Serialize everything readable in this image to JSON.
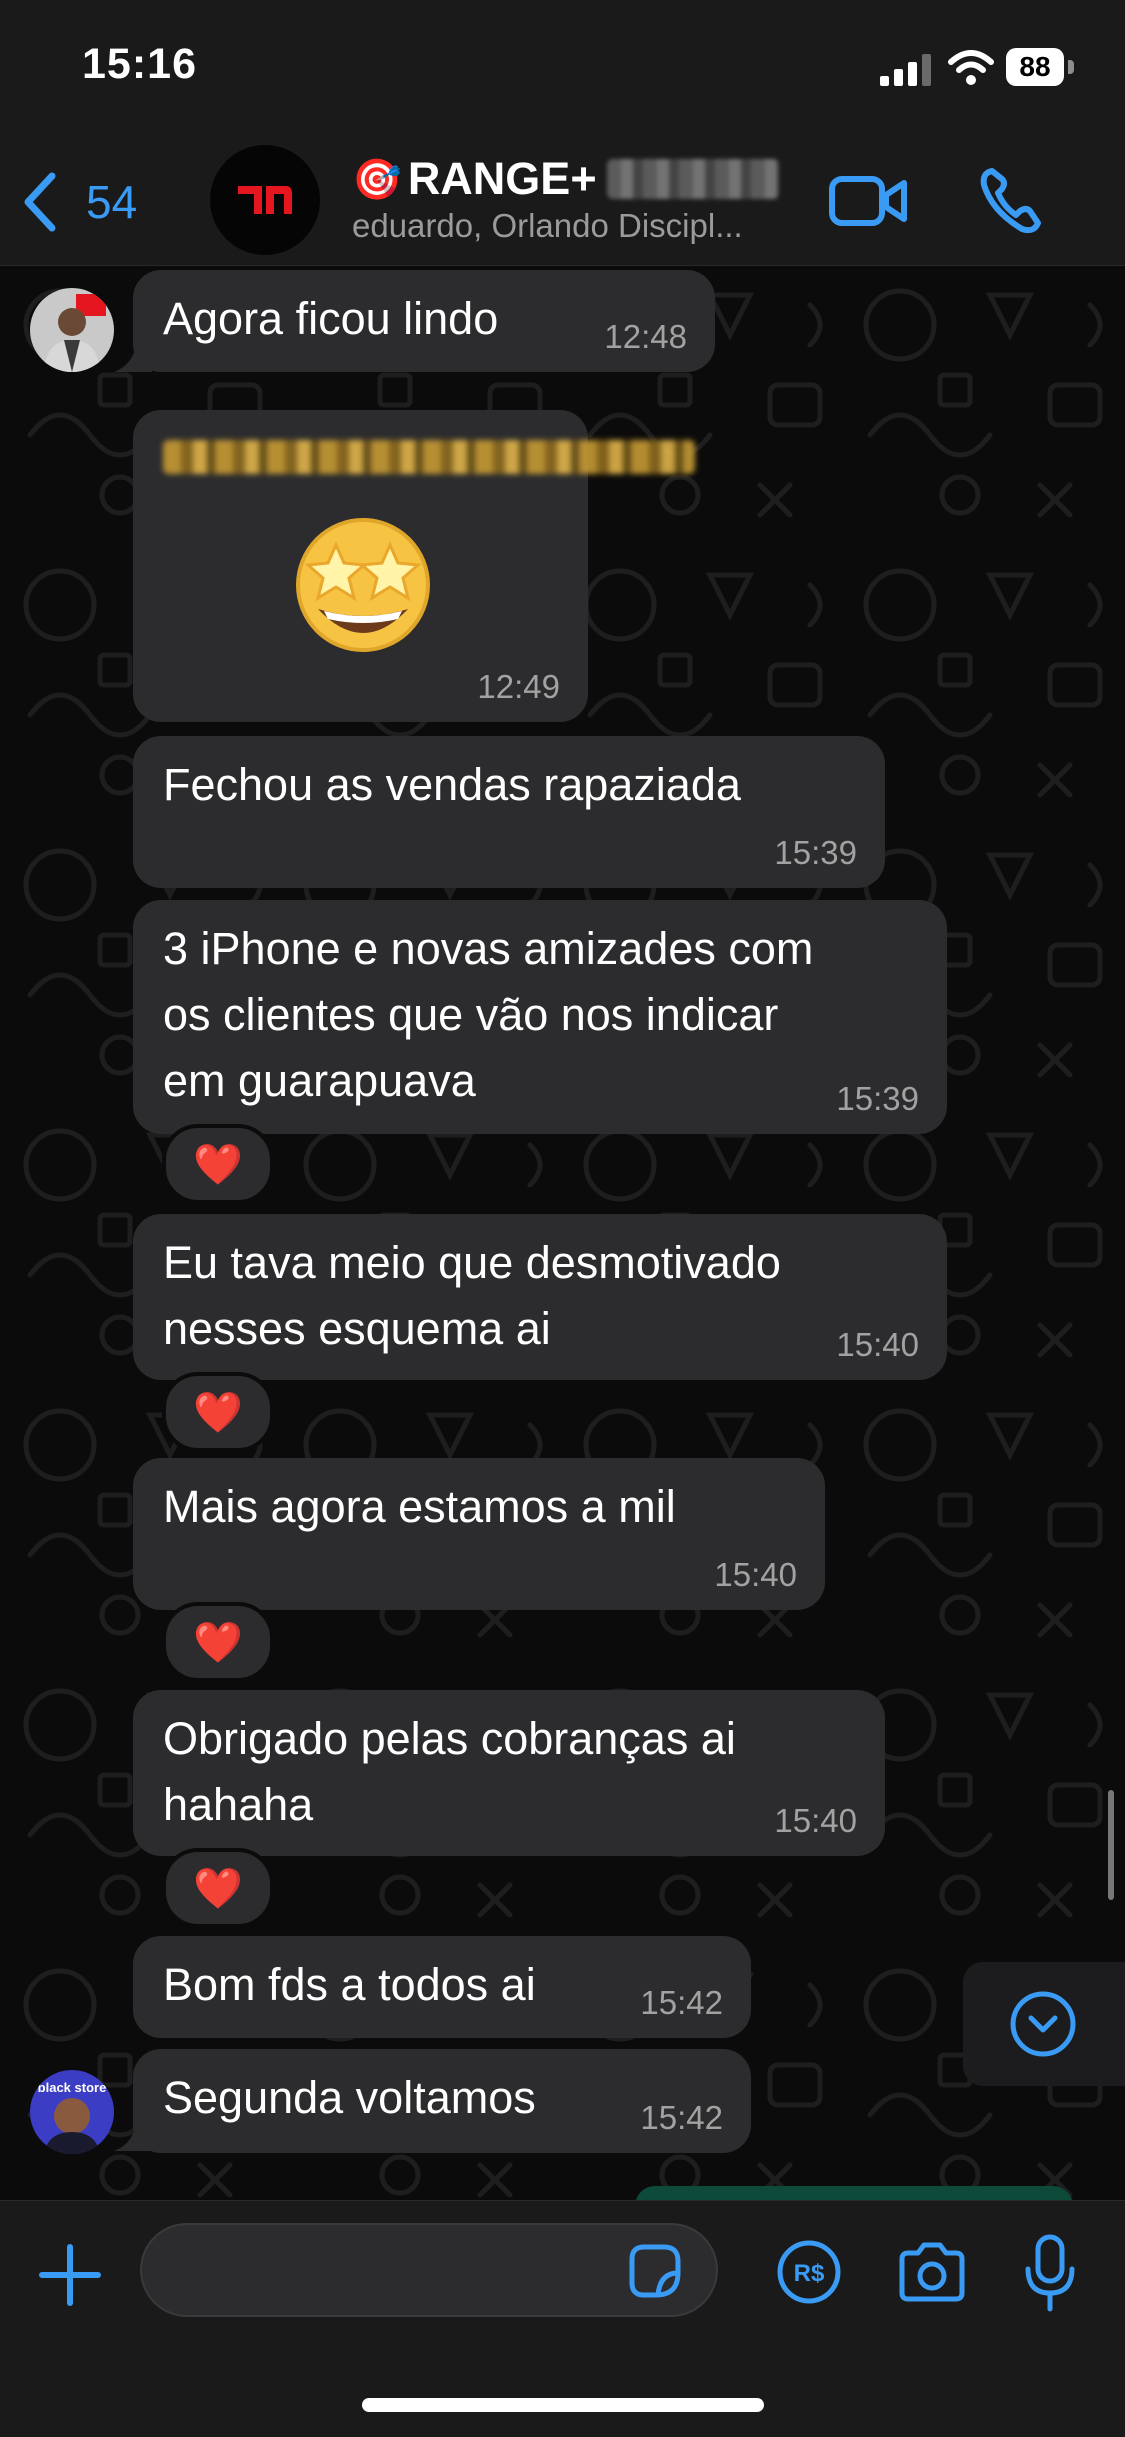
{
  "status_bar": {
    "time": "15:16",
    "battery": "88"
  },
  "header": {
    "back_count": "54",
    "title_emoji": "🎯",
    "title": "RANGE+",
    "members": "eduardo, Orlando Discipl..."
  },
  "messages": [
    {
      "text": "Agora ficou lindo",
      "time": "12:48"
    },
    {
      "type": "sticker",
      "sticker": "🤩",
      "time": "12:49"
    },
    {
      "text": "Fechou as vendas rapaziada",
      "time": "15:39"
    },
    {
      "lines": [
        "3 iPhone e novas amizades com",
        "os clientes que vão nos indicar",
        "em guarapuava"
      ],
      "time": "15:39",
      "reaction": "❤️"
    },
    {
      "lines": [
        "Eu tava meio que desmotivado",
        "nesses esquema ai"
      ],
      "time": "15:40",
      "reaction": "❤️"
    },
    {
      "text": "Mais agora estamos a mil",
      "time": "15:40",
      "reaction": "❤️"
    },
    {
      "lines": [
        "Obrigado pelas cobranças ai",
        "hahaha"
      ],
      "time": "15:40",
      "reaction": "❤️"
    },
    {
      "text": "Bom fds a todos ai",
      "time": "15:42"
    },
    {
      "text": "Segunda voltamos",
      "time": "15:42"
    }
  ],
  "avatar_labels": {
    "black_store": "black store"
  },
  "input": {
    "placeholder": "",
    "value": ""
  },
  "colors": {
    "accent": "#3a9bf5",
    "bubble": "#2c2c2e",
    "background": "#0b0b0b",
    "bar": "#1a1a1a",
    "reaction_heart": "#ff2d47",
    "brand_red": "#e5161f"
  }
}
